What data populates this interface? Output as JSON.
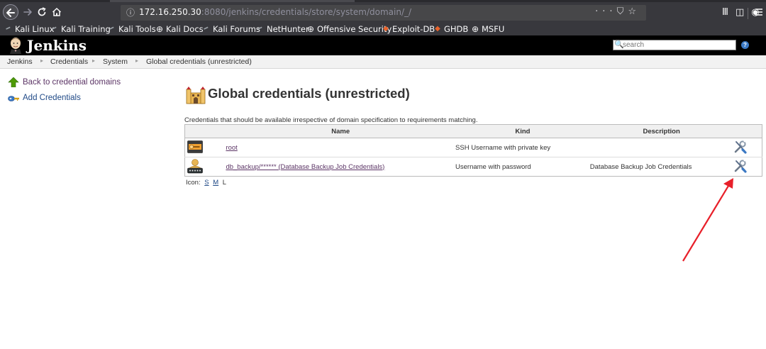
{
  "browser": {
    "url_host": "172.16.250.30",
    "url_rest": ":8080/jenkins/credentials/store/system/domain/_/",
    "bookmarks": [
      {
        "label": "Kali Linux",
        "icon": "kali-dragon-icon"
      },
      {
        "label": "Kali Training",
        "icon": "kali-dragon-icon"
      },
      {
        "label": "Kali Tools",
        "icon": "kali-dragon-icon"
      },
      {
        "label": "Kali Docs",
        "icon": "globe-icon"
      },
      {
        "label": "Kali Forums",
        "icon": "kali-dragon-icon"
      },
      {
        "label": "NetHunter",
        "icon": "kali-dragon-icon"
      },
      {
        "label": "Offensive Security",
        "icon": "globe-icon"
      },
      {
        "label": "Exploit-DB",
        "icon": "exploit-db-icon"
      },
      {
        "label": "GHDB",
        "icon": "exploit-db-icon"
      },
      {
        "label": "MSFU",
        "icon": "globe-icon"
      }
    ]
  },
  "header": {
    "title": "Jenkins",
    "search_placeholder": "search",
    "help": "?"
  },
  "breadcrumb": [
    "Jenkins",
    "Credentials",
    "System",
    "Global credentials (unrestricted)"
  ],
  "sidebar": {
    "items": [
      {
        "label": "Back to credential domains",
        "icon": "up-arrow-icon"
      },
      {
        "label": "Add Credentials",
        "icon": "key-icon"
      }
    ]
  },
  "main": {
    "title": "Global credentials (unrestricted)",
    "description": "Credentials that should be available irrespective of domain specification to requirements matching.",
    "table": {
      "columns": [
        "Name",
        "Kind",
        "Description"
      ],
      "rows": [
        {
          "name": "root",
          "kind": "SSH Username with private key",
          "description": "",
          "icon": "ssh-key-icon"
        },
        {
          "name": "db_backup/****** (Database Backup Job Credentials)",
          "kind": "Username with password",
          "description": "Database Backup Job Credentials",
          "icon": "user-password-icon"
        }
      ]
    },
    "icon_size": {
      "label": "Icon:",
      "small": "S",
      "medium": "M",
      "large": "L"
    }
  },
  "colors": {
    "annotation_arrow": "#e8202a",
    "jenkins_header": "#000000",
    "link": "#204a87",
    "visited_link": "#5c3566"
  }
}
